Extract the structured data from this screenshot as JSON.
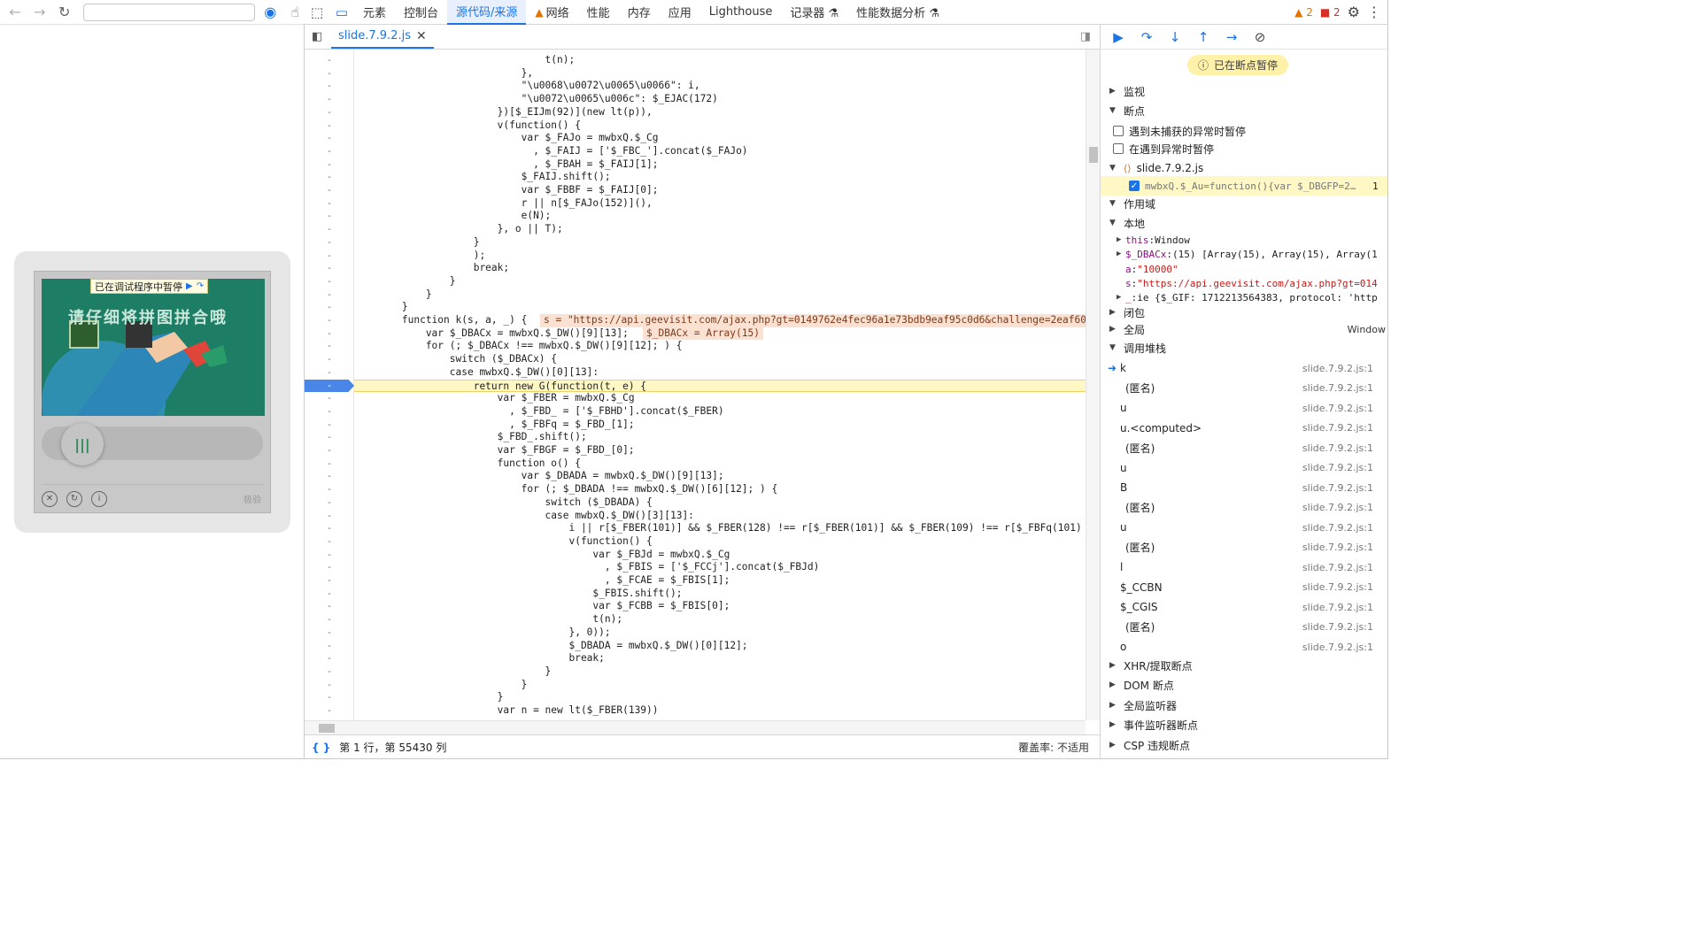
{
  "browser": {
    "captcha": {
      "paused_label": "已在调试程序中暂停",
      "puzzle_hint": "请仔细将拼图拼合哦",
      "slider_knob": "|||",
      "brand": "极验"
    }
  },
  "devtools": {
    "tabs": [
      {
        "label": "元素"
      },
      {
        "label": "控制台"
      },
      {
        "label": "源代码/来源"
      },
      {
        "label": "网络"
      },
      {
        "label": "性能"
      },
      {
        "label": "内存"
      },
      {
        "label": "应用"
      },
      {
        "label": "Lighthouse"
      },
      {
        "label": "记录器 ⚗"
      },
      {
        "label": "性能数据分析 ⚗"
      }
    ],
    "warnings_count": "2",
    "errors_count": "2"
  },
  "editor": {
    "file_tab": "slide.7.9.2.js",
    "status_position": "第 1 行，第 55430 列",
    "coverage": "覆盖率: 不适用",
    "lines": [
      {
        "t": "                                t(n);"
      },
      {
        "t": "                            },"
      },
      {
        "t": "                            \"\\u0068\\u0072\\u0065\\u0066\": i,"
      },
      {
        "t": "                            \"\\u0072\\u0065\\u006c\": $_EJAC(172)"
      },
      {
        "t": "                        })[$_EIJm(92)](new lt(p)),"
      },
      {
        "t": "                        v(function() {"
      },
      {
        "t": "                            var $_FAJo = mwbxQ.$_Cg"
      },
      {
        "t": "                              , $_FAIJ = ['$_FBC_'].concat($_FAJo)"
      },
      {
        "t": "                              , $_FBAH = $_FAIJ[1];"
      },
      {
        "t": "                            $_FAIJ.shift();"
      },
      {
        "t": "                            var $_FBBF = $_FAIJ[0];"
      },
      {
        "t": "                            r || n[$_FAJo(152)](),"
      },
      {
        "t": "                            e(N);"
      },
      {
        "t": "                        }, o || T);"
      },
      {
        "t": "                    }"
      },
      {
        "t": "                    );"
      },
      {
        "t": "                    break;"
      },
      {
        "t": "                }"
      },
      {
        "t": "            }"
      },
      {
        "t": "        }"
      },
      {
        "t": "        function k(s, a, _) {"
      },
      {
        "t": "            var $_DBACx = mwbxQ.$_DW()[9][13];"
      },
      {
        "t": "            for (; $_DBACx !== mwbxQ.$_DW()[9][12]; ) {"
      },
      {
        "t": "                switch ($_DBACx) {"
      },
      {
        "t": "                case mwbxQ.$_DW()[0][13]:"
      },
      {
        "t": "                    return new G(function(t, e) {"
      },
      {
        "t": "                        var $_FBER = mwbxQ.$_Cg"
      },
      {
        "t": "                          , $_FBD_ = ['$_FBHD'].concat($_FBER)"
      },
      {
        "t": "                          , $_FBFq = $_FBD_[1];"
      },
      {
        "t": "                        $_FBD_.shift();"
      },
      {
        "t": "                        var $_FBGF = $_FBD_[0];"
      },
      {
        "t": "                        function o() {"
      },
      {
        "t": "                            var $_DBADA = mwbxQ.$_DW()[9][13];"
      },
      {
        "t": "                            for (; $_DBADA !== mwbxQ.$_DW()[6][12]; ) {"
      },
      {
        "t": "                                switch ($_DBADA) {"
      },
      {
        "t": "                                case mwbxQ.$_DW()[3][13]:"
      },
      {
        "t": "                                    i || r[$_FBER(101)] && $_FBER(128) !== r[$_FBER(101)] && $_FBER(109) !== r[$_FBFq(101)"
      },
      {
        "t": "                                    v(function() {"
      },
      {
        "t": "                                        var $_FBJd = mwbxQ.$_Cg"
      },
      {
        "t": "                                          , $_FBIS = ['$_FCCj'].concat($_FBJd)"
      },
      {
        "t": "                                          , $_FCAE = $_FBIS[1];"
      },
      {
        "t": "                                        $_FBIS.shift();"
      },
      {
        "t": "                                        var $_FCBB = $_FBIS[0];"
      },
      {
        "t": "                                        t(n);"
      },
      {
        "t": "                                    }, 0));"
      },
      {
        "t": "                                    $_DBADA = mwbxQ.$_DW()[0][12];"
      },
      {
        "t": "                                    break;"
      },
      {
        "t": "                                }"
      },
      {
        "t": "                            }"
      },
      {
        "t": "                        }"
      },
      {
        "t": "                        var n = new lt($_FBER(139))"
      }
    ],
    "inline_values": {
      "k_params": "s = \"https://api.geevisit.com/ajax.php?gt=0149762e4fec96a1e73bdb9eaf95c0d6&challenge=2eaf60",
      "dbacx": "$_DBACx = Array(15)"
    }
  },
  "debugger": {
    "paused_label": "已在断点暂停",
    "sections": {
      "watch": "监视",
      "breakpoints": "断点",
      "pause_uncaught": "遇到未捕获的异常时暂停",
      "pause_caught": "在遇到异常时暂停",
      "bp_file": "slide.7.9.2.js",
      "bp_code": "mwbxQ.$_Au=function(){var $_DBGFP=2…",
      "bp_line": "1",
      "scope": "作用域",
      "local": "本地",
      "closure": "闭包",
      "global": "全局",
      "global_value": "Window",
      "call_stack": "调用堆栈",
      "xhr": "XHR/提取断点",
      "dom": "DOM 断点",
      "global_listeners": "全局监听器",
      "event_listeners": "事件监听器断点",
      "csp": "CSP 违规断点"
    },
    "scope_rows": [
      {
        "key": "this",
        "val": "Window",
        "type": "plain"
      },
      {
        "key": "$_DBACx",
        "val": "(15) [Array(15), Array(15), Array(1",
        "type": "plain"
      },
      {
        "key": "a",
        "val": "\"10000\"",
        "type": "str"
      },
      {
        "key": "s",
        "val": "\"https://api.geevisit.com/ajax.php?gt=014",
        "type": "str"
      },
      {
        "key": "_",
        "val": "ie {$_GIF: 1712213564383, protocol: 'http",
        "type": "plain"
      }
    ],
    "frames": [
      {
        "name": "k",
        "loc": "slide.7.9.2.js:1"
      },
      {
        "name": "(匿名)",
        "loc": "slide.7.9.2.js:1"
      },
      {
        "name": "u",
        "loc": "slide.7.9.2.js:1"
      },
      {
        "name": "u.<computed>",
        "loc": "slide.7.9.2.js:1"
      },
      {
        "name": "(匿名)",
        "loc": "slide.7.9.2.js:1"
      },
      {
        "name": "u",
        "loc": "slide.7.9.2.js:1"
      },
      {
        "name": "B",
        "loc": "slide.7.9.2.js:1"
      },
      {
        "name": "(匿名)",
        "loc": "slide.7.9.2.js:1"
      },
      {
        "name": "u",
        "loc": "slide.7.9.2.js:1"
      },
      {
        "name": "(匿名)",
        "loc": "slide.7.9.2.js:1"
      },
      {
        "name": "l",
        "loc": "slide.7.9.2.js:1"
      },
      {
        "name": "$_CCBN",
        "loc": "slide.7.9.2.js:1"
      },
      {
        "name": "$_CGIS",
        "loc": "slide.7.9.2.js:1"
      },
      {
        "name": "(匿名)",
        "loc": "slide.7.9.2.js:1"
      },
      {
        "name": "o",
        "loc": "slide.7.9.2.js:1"
      }
    ]
  }
}
